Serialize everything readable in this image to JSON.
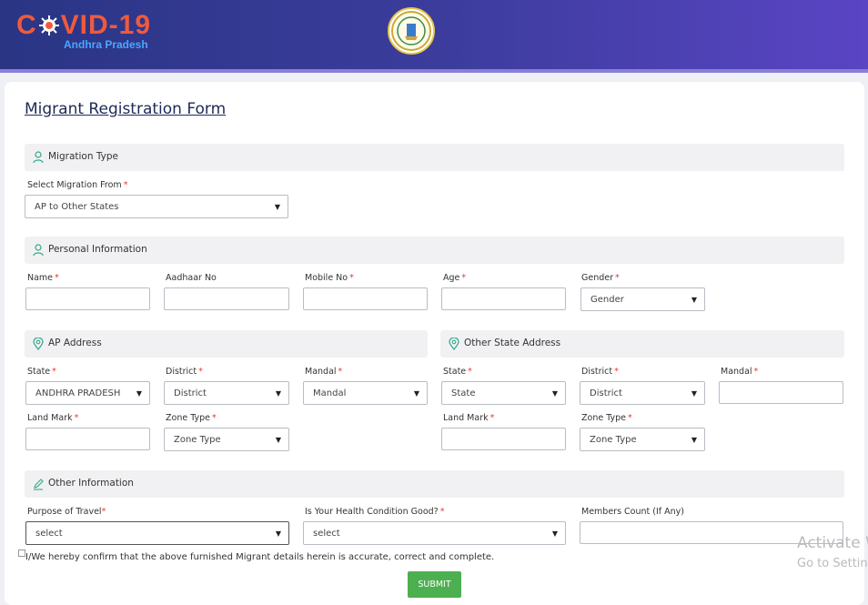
{
  "header": {
    "logo_title": "C VID-19",
    "logo_subtitle": "Andhra Pradesh"
  },
  "form": {
    "title": "Migrant Registration Form",
    "sections": {
      "migration_type": "Migration Type",
      "personal_info": "Personal Information",
      "ap_address": "AP Address",
      "other_state_address": "Other State Address",
      "other_info": "Other Information"
    },
    "migration": {
      "select_from_label": "Select Migration From",
      "select_from_value": "AP to Other States"
    },
    "personal": {
      "name_label": "Name",
      "aadhaar_label": "Aadhaar No",
      "mobile_label": "Mobile No",
      "age_label": "Age",
      "gender_label": "Gender",
      "gender_value": "Gender"
    },
    "ap_address": {
      "state_label": "State",
      "state_value": "ANDHRA PRADESH",
      "district_label": "District",
      "district_value": "District",
      "mandal_label": "Mandal",
      "mandal_value": "Mandal",
      "landmark_label": "Land Mark",
      "zone_label": "Zone Type",
      "zone_value": "Zone Type"
    },
    "other_address": {
      "state_label": "State",
      "state_value": "State",
      "district_label": "District",
      "district_value": "District",
      "mandal_label": "Mandal",
      "landmark_label": "Land Mark",
      "zone_label": "Zone Type",
      "zone_value": "Zone Type"
    },
    "other": {
      "purpose_label": "Purpose of Travel",
      "purpose_value": "select",
      "health_label": "Is Your Health Condition Good?",
      "health_value": "select",
      "members_label": "Members Count (If Any)"
    },
    "required_mark": "*",
    "confirm_text": "I/We hereby confirm that the above furnished  Migrant details herein is accurate, correct and complete.",
    "submit_label": "SUBMIT"
  },
  "watermark": {
    "line1": "Activate W",
    "line2": "Go to Settin"
  },
  "colors": {
    "header_start": "#2a3584",
    "header_end": "#5a45c4",
    "logo_red": "#f05a3c",
    "logo_blue": "#4aa6ff",
    "section_icon": "#2fa889",
    "required": "#e53935",
    "submit": "#4caf50"
  }
}
